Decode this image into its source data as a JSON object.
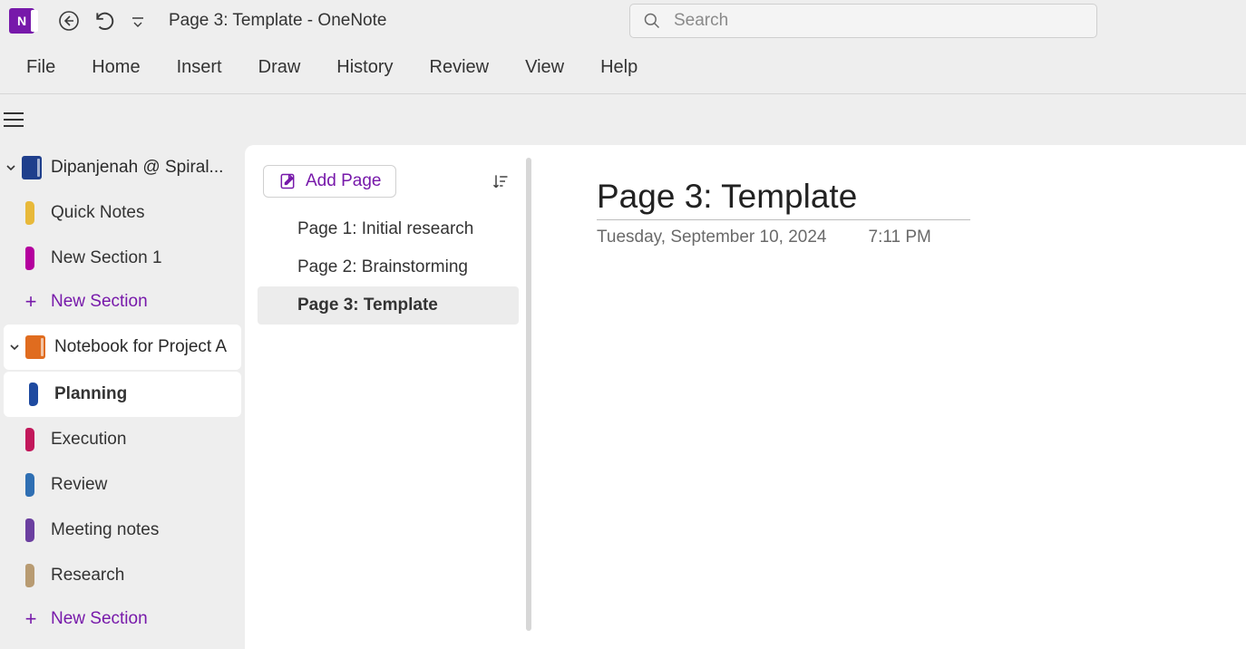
{
  "app": {
    "logo_letter": "N",
    "title": "Page 3: Template  -  OneNote"
  },
  "search": {
    "placeholder": "Search"
  },
  "ribbon": {
    "tabs": [
      "File",
      "Home",
      "Insert",
      "Draw",
      "History",
      "Review",
      "View",
      "Help"
    ]
  },
  "sidebar": {
    "notebooks": [
      {
        "name": "Dipanjenah @ Spiral...",
        "icon_color": "#1f3f8c",
        "expanded": true,
        "selected": false,
        "sections": [
          {
            "label": "Quick Notes",
            "color": "#e8b93a",
            "selected": false
          },
          {
            "label": "New Section 1",
            "color": "#b4009e",
            "selected": false
          }
        ],
        "new_section_label": "New Section"
      },
      {
        "name": "Notebook for Project A",
        "icon_color": "#e06c1f",
        "expanded": true,
        "selected": true,
        "sections": [
          {
            "label": "Planning",
            "color": "#1e4aa0",
            "selected": true
          },
          {
            "label": "Execution",
            "color": "#c2185b",
            "selected": false
          },
          {
            "label": "Review",
            "color": "#2f6fb3",
            "selected": false
          },
          {
            "label": "Meeting notes",
            "color": "#6b3fa0",
            "selected": false
          },
          {
            "label": "Research",
            "color": "#b89b72",
            "selected": false
          }
        ],
        "new_section_label": "New Section"
      }
    ]
  },
  "page_list": {
    "add_page_label": "Add Page",
    "pages": [
      {
        "title": "Page 1: Initial research",
        "selected": false
      },
      {
        "title": "Page 2: Brainstorming",
        "selected": false
      },
      {
        "title": "Page 3: Template",
        "selected": true
      }
    ]
  },
  "canvas": {
    "title": "Page 3: Template",
    "date": "Tuesday, September 10, 2024",
    "time": "7:11 PM"
  }
}
